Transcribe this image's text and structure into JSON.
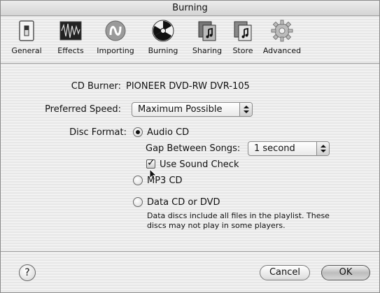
{
  "window": {
    "title": "Burning"
  },
  "toolbar": {
    "items": [
      {
        "label": "General",
        "icon": "switch-icon"
      },
      {
        "label": "Effects",
        "icon": "waveform-icon"
      },
      {
        "label": "Importing",
        "icon": "import-icon"
      },
      {
        "label": "Burning",
        "icon": "radiation-icon"
      },
      {
        "label": "Sharing",
        "icon": "sharing-icon"
      },
      {
        "label": "Store",
        "icon": "store-icon"
      },
      {
        "label": "Advanced",
        "icon": "gear-icon"
      }
    ]
  },
  "content": {
    "cd_burner_label": "CD Burner:",
    "cd_burner_value": "PIONEER DVD-RW  DVR-105",
    "speed_label": "Preferred Speed:",
    "speed_value": "Maximum Possible",
    "disc_format_label": "Disc Format:",
    "options": {
      "audio_cd": "Audio CD",
      "mp3_cd": "MP3 CD",
      "data_cd": "Data CD or DVD"
    },
    "selected_format": "Audio CD",
    "gap_label": "Gap Between Songs:",
    "gap_value": "1 second",
    "sound_check_label": "Use Sound Check",
    "sound_check_checked": true,
    "data_note_1": "Data discs include all files in the playlist.  These",
    "data_note_2": "discs may not play in some players."
  },
  "footer": {
    "help": "?",
    "cancel": "Cancel",
    "ok": "OK"
  }
}
